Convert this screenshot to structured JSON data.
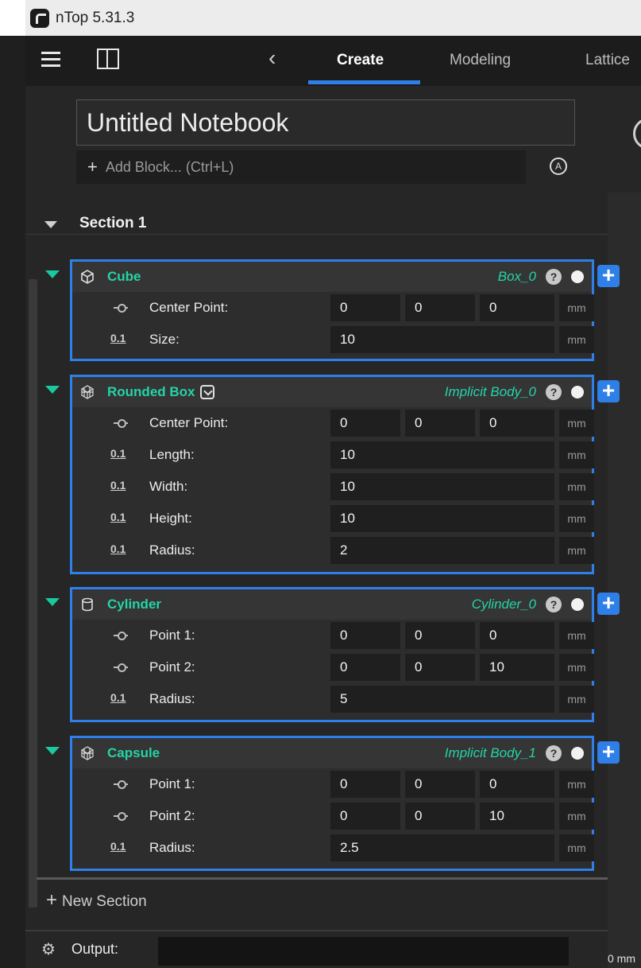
{
  "app": {
    "title": "nTop 5.31.3"
  },
  "toolbar": {
    "tabs": [
      {
        "label": "Create",
        "active": true
      },
      {
        "label": "Modeling",
        "active": false
      },
      {
        "label": "Lattice",
        "active": false
      }
    ]
  },
  "notebook": {
    "title": "Untitled Notebook",
    "add_block_placeholder": "Add Block... (Ctrl+L)"
  },
  "section": {
    "title": "Section 1",
    "blocks": [
      {
        "name": "Cube",
        "variable": "Box_0",
        "rows": [
          {
            "label": "Center Point:",
            "type": "point",
            "values": [
              "0",
              "0",
              "0"
            ],
            "unit": "mm"
          },
          {
            "label": "Size:",
            "type": "scalar",
            "values": [
              "10"
            ],
            "unit": "mm"
          }
        ]
      },
      {
        "name": "Rounded Box",
        "variable": "Implicit Body_0",
        "rows": [
          {
            "label": "Center Point:",
            "type": "point",
            "values": [
              "0",
              "0",
              "0"
            ],
            "unit": "mm"
          },
          {
            "label": "Length:",
            "type": "scalar",
            "values": [
              "10"
            ],
            "unit": "mm"
          },
          {
            "label": "Width:",
            "type": "scalar",
            "values": [
              "10"
            ],
            "unit": "mm"
          },
          {
            "label": "Height:",
            "type": "scalar",
            "values": [
              "10"
            ],
            "unit": "mm"
          },
          {
            "label": "Radius:",
            "type": "scalar",
            "values": [
              "2"
            ],
            "unit": "mm"
          }
        ]
      },
      {
        "name": "Cylinder",
        "variable": "Cylinder_0",
        "rows": [
          {
            "label": "Point 1:",
            "type": "point",
            "values": [
              "0",
              "0",
              "0"
            ],
            "unit": "mm"
          },
          {
            "label": "Point 2:",
            "type": "point",
            "values": [
              "0",
              "0",
              "10"
            ],
            "unit": "mm"
          },
          {
            "label": "Radius:",
            "type": "scalar",
            "values": [
              "5"
            ],
            "unit": "mm"
          }
        ]
      },
      {
        "name": "Capsule",
        "variable": "Implicit Body_1",
        "rows": [
          {
            "label": "Point 1:",
            "type": "point",
            "values": [
              "0",
              "0",
              "0"
            ],
            "unit": "mm"
          },
          {
            "label": "Point 2:",
            "type": "point",
            "values": [
              "0",
              "0",
              "10"
            ],
            "unit": "mm"
          },
          {
            "label": "Radius:",
            "type": "scalar",
            "values": [
              "2.5"
            ],
            "unit": "mm"
          }
        ]
      }
    ]
  },
  "scalar_icon_text": "0.1",
  "help_glyph": "?",
  "new_section_label": "New Section",
  "output": {
    "label": "Output:",
    "value": ""
  },
  "viewport": {
    "ruler_label": "0 mm"
  },
  "colors": {
    "accent": "#2f7fe8",
    "block_name": "#24d4a7",
    "background": "#262626"
  }
}
